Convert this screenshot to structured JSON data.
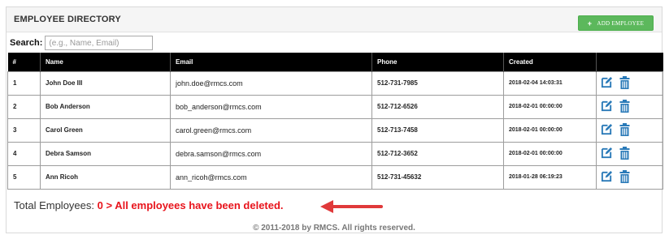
{
  "panel": {
    "title": "EMPLOYEE DIRECTORY",
    "add_button": {
      "icon": "plus-icon",
      "label": "ADD EMPLOYEE"
    }
  },
  "search": {
    "label": "Search:",
    "placeholder": "(e.g., Name, Email)",
    "value": ""
  },
  "table": {
    "headers": [
      "#",
      "Name",
      "Email",
      "Phone",
      "Created",
      ""
    ],
    "rows": [
      {
        "id": "1",
        "name": "John Doe III",
        "email": "john.doe@rmcs.com",
        "phone": "512-731-7985",
        "created": "2018-02-04 14:03:31"
      },
      {
        "id": "2",
        "name": "Bob Anderson",
        "email": "bob_anderson@rmcs.com",
        "phone": "512-712-6526",
        "created": "2018-02-01 00:00:00"
      },
      {
        "id": "3",
        "name": "Carol Green",
        "email": "carol.green@rmcs.com",
        "phone": "512-713-7458",
        "created": "2018-02-01 00:00:00"
      },
      {
        "id": "4",
        "name": "Debra Samson",
        "email": "debra.samson@rmcs.com",
        "phone": "512-712-3652",
        "created": "2018-02-01 00:00:00"
      },
      {
        "id": "5",
        "name": "Ann Ricoh",
        "email": "ann_ricoh@rmcs.com",
        "phone": "512-731-45632",
        "created": "2018-01-28 06:19:23"
      }
    ],
    "row_actions": [
      "edit-icon",
      "trash-icon"
    ]
  },
  "total": {
    "label": "Total Employees:",
    "message": "0 > All employees have been deleted."
  },
  "footer": {
    "text": "© 2011-2018 by RMCS. All rights reserved."
  },
  "colors": {
    "header_bg": "#000000",
    "add_button": "#5cb85c",
    "action_icon": "#2a7ab8",
    "alert_text": "#e8141c",
    "arrow": "#e0393a"
  }
}
